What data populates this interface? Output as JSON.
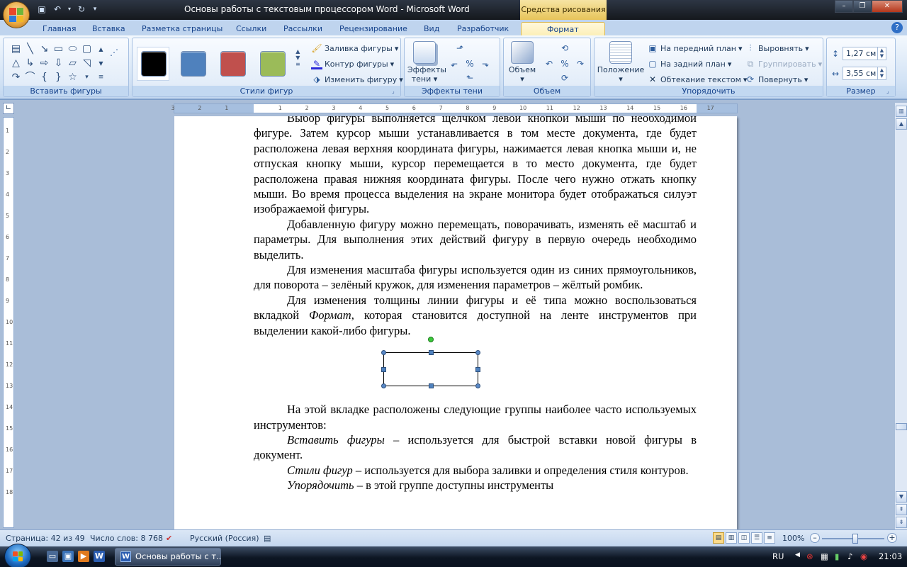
{
  "window": {
    "title": "Основы работы с текстовым процессором Word - Microsoft Word",
    "contextual_tab_group": "Средства рисования"
  },
  "tabs": [
    "Главная",
    "Вставка",
    "Разметка страницы",
    "Ссылки",
    "Рассылки",
    "Рецензирование",
    "Вид",
    "Разработчик",
    "Формат"
  ],
  "ribbon": {
    "insert_shapes": {
      "label": "Вставить фигуры"
    },
    "shape_styles": {
      "label": "Стили фигур",
      "swatches": [
        "#000000",
        "#4f81bd",
        "#c0504d",
        "#9bbb59"
      ],
      "fill": "Заливка фигуры",
      "outline": "Контур фигуры",
      "change": "Изменить фигуру"
    },
    "shadow_effects": {
      "label": "Эффекты тени",
      "button": "Эффекты тени"
    },
    "volume": {
      "label": "Объем",
      "button": "Объем"
    },
    "arrange": {
      "label": "Упорядочить",
      "position": "Положение",
      "bring_front": "На передний план",
      "send_back": "На задний план",
      "text_wrap": "Обтекание текстом",
      "align": "Выровнять",
      "group": "Группировать",
      "rotate": "Повернуть"
    },
    "size": {
      "label": "Размер",
      "height": "1,27 см",
      "width": "3,55 см"
    }
  },
  "ruler": {
    "marks": [
      "3",
      "2",
      "1",
      "1",
      "2",
      "3",
      "4",
      "5",
      "6",
      "7",
      "8",
      "9",
      "10",
      "11",
      "12",
      "13",
      "14",
      "15",
      "16",
      "17"
    ]
  },
  "vruler": {
    "marks": [
      "1",
      "2",
      "3",
      "4",
      "5",
      "6",
      "7",
      "8",
      "9",
      "10",
      "11",
      "12",
      "13",
      "14",
      "15",
      "16",
      "17",
      "18"
    ]
  },
  "document": {
    "p1": "Выбор фигуры выполняется щелчком левой кнопкой мыши по необходимой фигуре. Затем курсор мыши устанавливается в том месте документа, где будет расположена левая верхняя координата фигуры, нажимается левая кнопка мыши и, не отпуская кнопку мыши, курсор перемещается в то место документа, где будет расположена правая нижняя координата фигуры. После чего нужно отжать кнопку мыши. Во время процесса выделения на экране монитора будет отображаться силуэт изображаемой фигуры.",
    "p2": "Добавленную фигуру можно перемещать, поворачивать, изменять её масштаб и параметры. Для выполнения этих действий фигуру в первую очередь необходимо выделить.",
    "p3": "Для изменения масштаба фигуры используется один из синих прямоугольников, для поворота – зелёный кружок, для изменения параметров – жёлтый ромбик.",
    "p4_before": "Для изменения толщины линии фигуры и её типа можно воспользоваться вкладкой ",
    "p4_italic": "Формат",
    "p4_after": ", которая становится доступной на ленте инструментов при выделении какой-либо фигуры.",
    "p5": "На этой вкладке расположены следующие группы наиболее часто используемых инструментов:",
    "p6_italic": "Вставить фигуры",
    "p6_after": " – используется для быстрой вставки новой фигуры в документ.",
    "p7_italic": "Стили фигур",
    "p7_after": " – используется для выбора заливки и определения стиля контуров.",
    "p8_italic": "Упорядочить",
    "p8_after": " – в этой группе доступны инструменты"
  },
  "status": {
    "page": "Страница: 42 из 49",
    "words": "Число слов: 8 768",
    "language": "Русский (Россия)",
    "zoom": "100%",
    "zoom_level": 1.0
  },
  "taskbar": {
    "task_label": "Основы работы с т...",
    "lang": "RU",
    "time": "21:03"
  },
  "colors": {
    "ribbon_bg": "#d3e3f5",
    "workspace_bg": "#a9bdd8",
    "contextual_tab": "#e7c45a",
    "selection_handle": "#4f81bd",
    "rotate_handle": "#3cc93c"
  }
}
